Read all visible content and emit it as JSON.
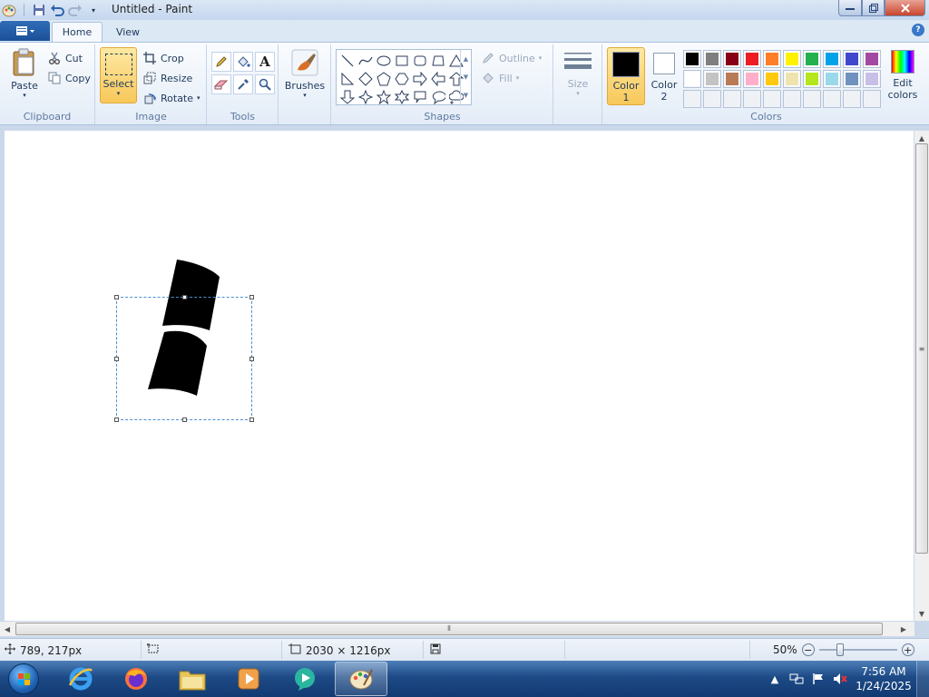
{
  "window": {
    "title": "Untitled - Paint"
  },
  "tabs": [
    {
      "label": "Home"
    },
    {
      "label": "View"
    }
  ],
  "ribbon": {
    "clipboard": {
      "label": "Clipboard",
      "paste": "Paste",
      "cut": "Cut",
      "copy": "Copy"
    },
    "image": {
      "label": "Image",
      "select": "Select",
      "crop": "Crop",
      "resize": "Resize",
      "rotate": "Rotate"
    },
    "tools": {
      "label": "Tools"
    },
    "brushes": {
      "label": "Brushes"
    },
    "shapes": {
      "label": "Shapes",
      "outline": "Outline",
      "fill": "Fill"
    },
    "size": {
      "label": "Size"
    },
    "colors": {
      "label": "Colors",
      "color1": "Color",
      "color1_num": "1",
      "color2": "Color",
      "color2_num": "2",
      "edit1": "Edit",
      "edit2": "colors",
      "color1_value": "#000000",
      "color2_value": "#ffffff",
      "palette_row1": [
        "#000000",
        "#7f7f7f",
        "#880015",
        "#ed1c24",
        "#ff7f27",
        "#fff200",
        "#22b14c",
        "#00a2e8",
        "#3f48cc",
        "#a349a4"
      ],
      "palette_row2": [
        "#ffffff",
        "#c3c3c3",
        "#b97a57",
        "#ffaec9",
        "#ffc90e",
        "#efe4b0",
        "#b5e61d",
        "#99d9ea",
        "#7092be",
        "#c8bfe7"
      ]
    }
  },
  "status": {
    "cursor_pos": "789, 217px",
    "selection_size": "",
    "image_size": "2030 × 1216px",
    "zoom": "50%"
  },
  "taskbar": {
    "time": "7:56 AM",
    "date": "1/24/2025"
  }
}
